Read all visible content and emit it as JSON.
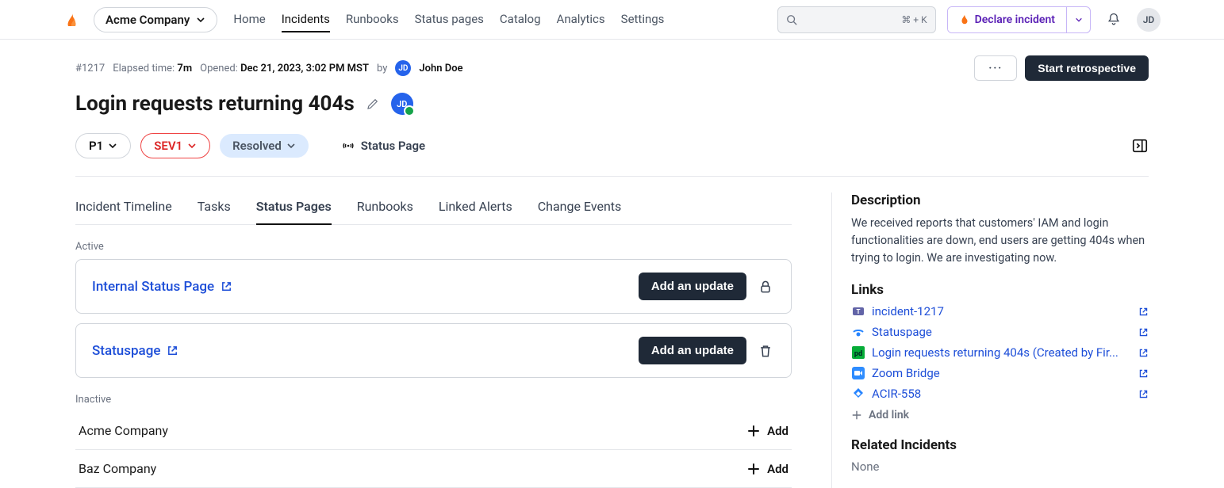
{
  "header": {
    "company": "Acme Company",
    "nav": [
      "Home",
      "Incidents",
      "Runbooks",
      "Status pages",
      "Catalog",
      "Analytics",
      "Settings"
    ],
    "nav_active": "Incidents",
    "search_shortcut": "⌘  + K",
    "declare_label": "Declare incident",
    "avatar": "JD"
  },
  "incident": {
    "id": "#1217",
    "elapsed_label": "Elapsed time:",
    "elapsed_value": "7m",
    "opened_label": "Opened:",
    "opened_value": "Dec 21, 2023, 3:02 PM MST",
    "by_label": "by",
    "opener_initials": "JD",
    "opener_name": "John Doe",
    "retrospective_btn": "Start retrospective",
    "title": "Login requests returning 404s",
    "priority": "P1",
    "severity": "SEV1",
    "status": "Resolved",
    "status_page_label": "Status Page"
  },
  "tabs": {
    "items": [
      "Incident Timeline",
      "Tasks",
      "Status Pages",
      "Runbooks",
      "Linked Alerts",
      "Change Events"
    ],
    "active": "Status Pages"
  },
  "status_pages": {
    "active_label": "Active",
    "inactive_label": "Inactive",
    "add_update_btn": "Add an update",
    "add_btn": "Add",
    "active": [
      {
        "name": "Internal Status Page",
        "action_icon": "lock"
      },
      {
        "name": "Statuspage",
        "action_icon": "trash"
      }
    ],
    "inactive": [
      {
        "name": "Acme Company"
      },
      {
        "name": "Baz Company"
      }
    ]
  },
  "sidebar": {
    "description_heading": "Description",
    "description_text": "We received reports that customers' IAM and login functionalities are down, end users are getting 404s when trying to login. We are investigating now.",
    "links_heading": "Links",
    "links": [
      {
        "icon": "teams",
        "text": "incident-1217"
      },
      {
        "icon": "statuspage",
        "text": "Statuspage"
      },
      {
        "icon": "pd",
        "text": "Login requests returning 404s (Created by Fir..."
      },
      {
        "icon": "zoom",
        "text": "Zoom Bridge"
      },
      {
        "icon": "jira",
        "text": "ACIR-558"
      }
    ],
    "add_link_label": "Add link",
    "related_heading": "Related Incidents",
    "related_none": "None"
  }
}
